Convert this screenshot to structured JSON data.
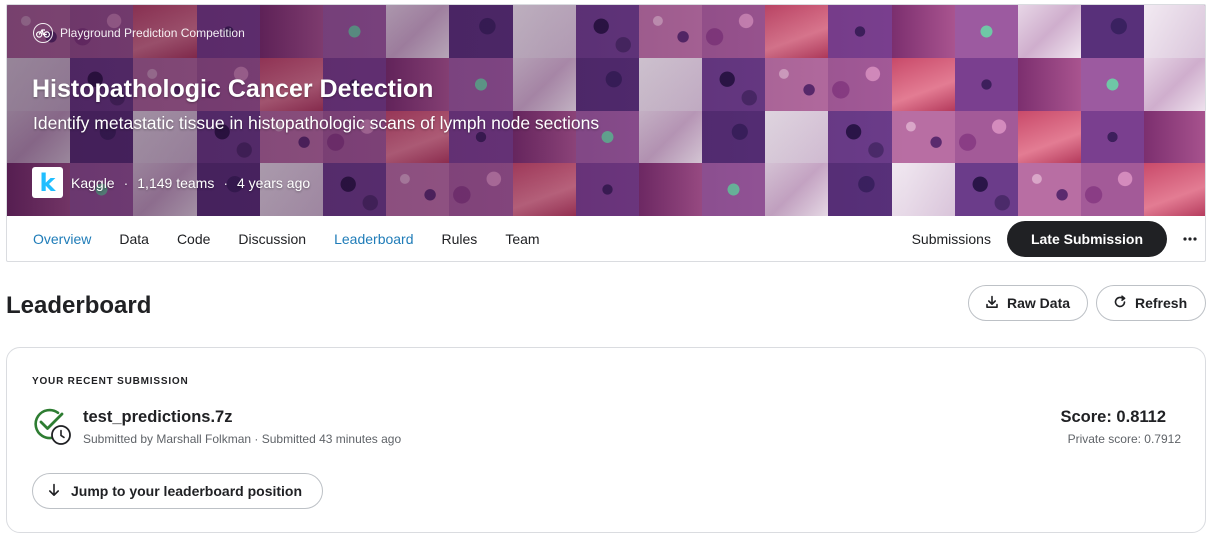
{
  "competition": {
    "type_label": "Playground Prediction Competition",
    "title": "Histopathologic Cancer Detection",
    "subtitle": "Identify metastatic tissue in histopathologic scans of lymph node sections",
    "host_logo_letter": "k",
    "host": "Kaggle",
    "teams": "1,149 teams",
    "age": "4 years ago"
  },
  "colors": {
    "accent": "#1f7cb8",
    "dark_button": "#202124",
    "success_green": "#2e7d32",
    "banner_purple": "#8a4a86",
    "banner_pink": "#c77fb0"
  },
  "tabs": [
    {
      "label": "Overview",
      "state": "hover-underlined"
    },
    {
      "label": "Data",
      "state": "normal"
    },
    {
      "label": "Code",
      "state": "normal"
    },
    {
      "label": "Discussion",
      "state": "normal"
    },
    {
      "label": "Leaderboard",
      "state": "active"
    },
    {
      "label": "Rules",
      "state": "normal"
    },
    {
      "label": "Team",
      "state": "normal"
    }
  ],
  "tab_actions": {
    "submissions": "Submissions",
    "late_submission": "Late Submission",
    "more_icon": "more-horizontal-icon"
  },
  "leaderboard": {
    "title": "Leaderboard",
    "raw_data": "Raw Data",
    "refresh": "Refresh"
  },
  "recent_submission": {
    "section_label": "YOUR RECENT SUBMISSION",
    "file_name": "test_predictions.7z",
    "submitted_by": "Submitted by Marshall Folkman · Submitted 43 minutes ago",
    "score": "Score: 0.8112",
    "private_score": "Private score: 0.7912",
    "jump_label": "Jump to your leaderboard position",
    "status_icon": "check-circle-clock-icon"
  }
}
